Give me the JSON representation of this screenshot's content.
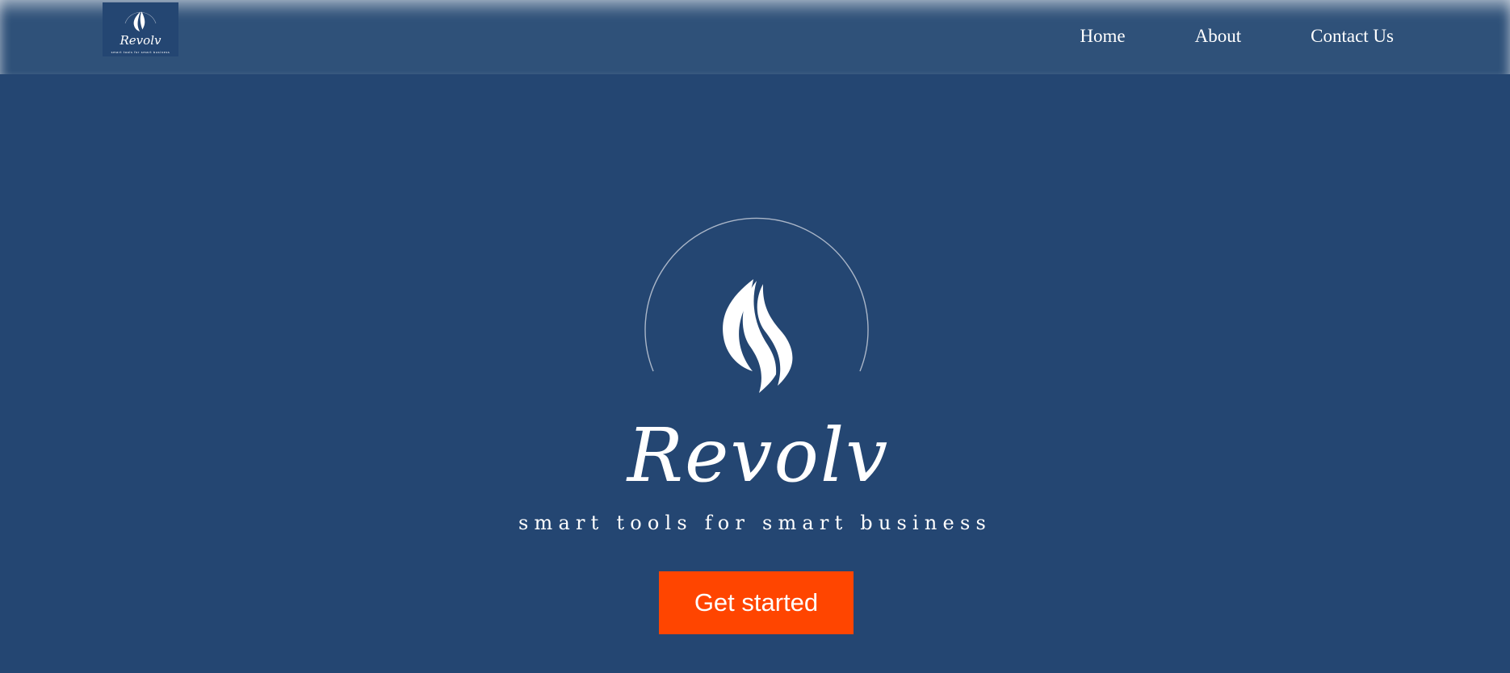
{
  "navbar": {
    "logo": {
      "brand": "Revolv",
      "tagline": "smart tools for smart business"
    },
    "links": [
      "Home",
      "About",
      "Contact Us"
    ]
  },
  "hero": {
    "brand": "Revolv",
    "tagline": "smart tools for smart business",
    "cta_label": "Get started",
    "icon": "flame-icon"
  },
  "colors": {
    "background": "#244672",
    "navbar": "#2f5179",
    "cta": "#ff4500",
    "text": "#ffffff"
  }
}
